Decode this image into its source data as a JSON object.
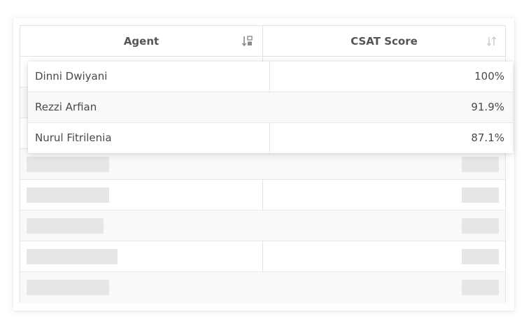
{
  "table": {
    "columns": [
      {
        "label": "Agent",
        "sort_icon": "sort-alpha-down-icon",
        "sort_active": true
      },
      {
        "label": "CSAT Score",
        "sort_icon": "sort-icon",
        "sort_active": false
      }
    ]
  },
  "rows": [
    {
      "agent": "Dinni Dwiyani",
      "csat": "100%"
    },
    {
      "agent": "Rezzi Arfian",
      "csat": "91.9%"
    },
    {
      "agent": "Nurul Fitrilenia",
      "csat": "87.1%"
    }
  ],
  "loading_rows": 5,
  "colors": {
    "border": "#e3e3e3",
    "header_text": "#555555",
    "skeleton": "#e6e6e6",
    "sort_active": "#8a8a8a",
    "sort_inactive": "#cfcfcf"
  }
}
